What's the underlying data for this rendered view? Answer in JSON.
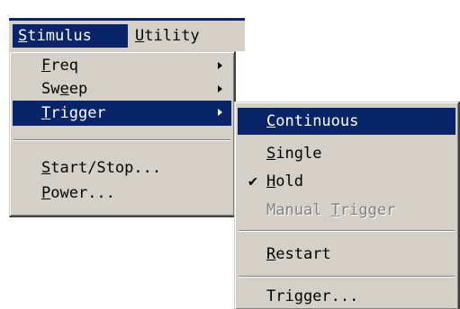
{
  "menubar": {
    "items": [
      {
        "label": "Stimulus",
        "accel": "S",
        "rest": "timulus"
      },
      {
        "label": "Utility",
        "accel": "U",
        "rest": "tility"
      }
    ]
  },
  "stimulus_menu": {
    "items": [
      {
        "pre": "",
        "accel": "F",
        "post": "req",
        "submenu": true
      },
      {
        "pre": "Sw",
        "accel": "e",
        "post": "ep",
        "submenu": true
      },
      {
        "pre": "",
        "accel": "T",
        "post": "rigger",
        "submenu": true
      },
      {
        "pre": "",
        "accel": "S",
        "post": "tart/Stop...",
        "submenu": false
      },
      {
        "pre": "",
        "accel": "P",
        "post": "ower...",
        "submenu": false
      }
    ]
  },
  "trigger_submenu": {
    "items": [
      {
        "pre": "",
        "accel": "C",
        "post": "ontinuous",
        "checked": false,
        "enabled": true
      },
      {
        "pre": "",
        "accel": "S",
        "post": "ingle",
        "checked": false,
        "enabled": true
      },
      {
        "pre": "",
        "accel": "H",
        "post": "old",
        "checked": true,
        "enabled": true
      },
      {
        "pre": "Manual ",
        "accel": "T",
        "post": "rigger",
        "checked": false,
        "enabled": false
      },
      {
        "pre": "",
        "accel": "R",
        "post": "estart",
        "checked": false,
        "enabled": true
      },
      {
        "pre": "Trigger...",
        "accel": "",
        "post": "",
        "checked": false,
        "enabled": true
      }
    ],
    "check_glyph": "✔"
  },
  "colors": {
    "highlight": "#0a246a",
    "menu_bg": "#d4d0c8",
    "disabled": "#808080"
  }
}
